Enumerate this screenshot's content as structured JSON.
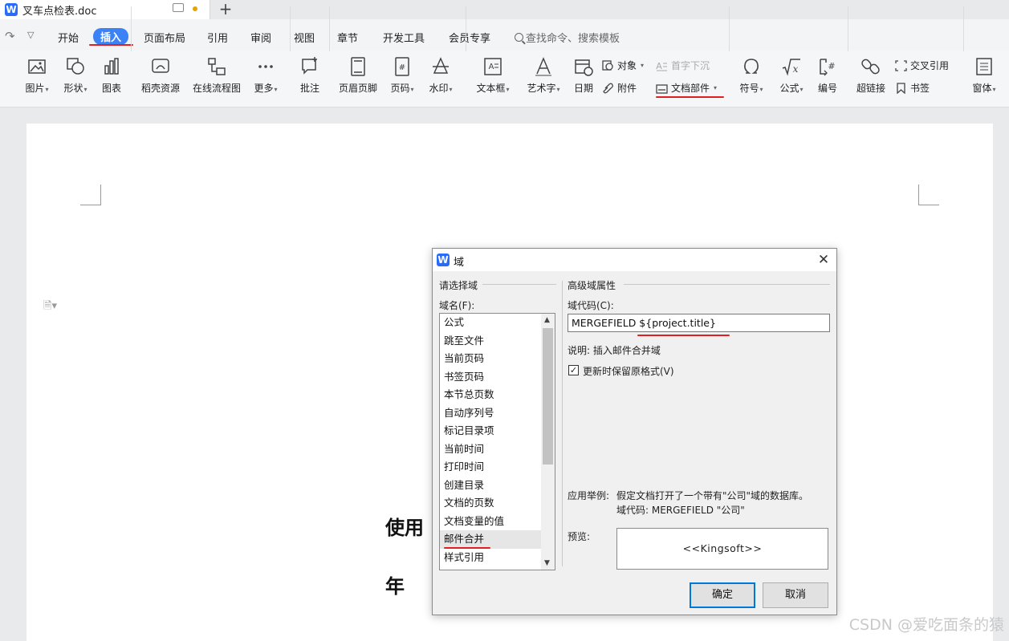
{
  "titlebar": {
    "app_logo": "W",
    "doc_name": "叉车点检表.doc",
    "new_tab": "+"
  },
  "menu": {
    "items": [
      "开始",
      "插入",
      "页面布局",
      "引用",
      "审阅",
      "视图",
      "章节",
      "开发工具",
      "会员专享"
    ],
    "active": "插入",
    "search_placeholder": "查找命令、搜索模板"
  },
  "ribbon": {
    "picture": "图片",
    "shape": "形状",
    "chart": "图表",
    "daoke": "稻壳资源",
    "flowchart": "在线流程图",
    "more": "更多",
    "comment": "批注",
    "header_footer": "页眉页脚",
    "page_number": "页码",
    "watermark": "水印",
    "textbox": "文本框",
    "wordart": "艺术字",
    "date": "日期",
    "object": "对象",
    "attachment": "附件",
    "dropcap": "首字下沉",
    "doc_parts": "文档部件",
    "symbol": "符号",
    "formula": "公式",
    "numbering": "编号",
    "hyperlink": "超链接",
    "cross_ref": "交叉引用",
    "bookmark": "书签",
    "window": "窗体"
  },
  "document": {
    "text1": "使用",
    "text2": "年"
  },
  "dialog": {
    "logo": "W",
    "title": "域",
    "close": "✕",
    "left_group": "请选择域",
    "field_name_label": "域名(F):",
    "fields": [
      "公式",
      "跳至文件",
      "当前页码",
      "书签页码",
      "本节总页数",
      "自动序列号",
      "标记目录项",
      "当前时间",
      "打印时间",
      "创建目录",
      "文档的页数",
      "文档变量的值",
      "邮件合并",
      "样式引用"
    ],
    "selected_field": "邮件合并",
    "right_group": "高级域属性",
    "field_code_label": "域代码(C):",
    "field_code_value": "MERGEFIELD ${project.title}",
    "description": "说明: 插入邮件合并域",
    "keep_format_label": "更新时保留原格式(V)",
    "keep_format_checked": "✓",
    "example_label": "应用举例:",
    "example_text": "假定文档打开了一个带有\"公司\"域的数据库。",
    "example_code": "域代码:  MERGEFIELD \"公司\"",
    "preview_label": "预览:",
    "preview_value": "<<Kingsoft>>",
    "ok": "确定",
    "cancel": "取消"
  },
  "watermark": "CSDN @爱吃面条的猿"
}
